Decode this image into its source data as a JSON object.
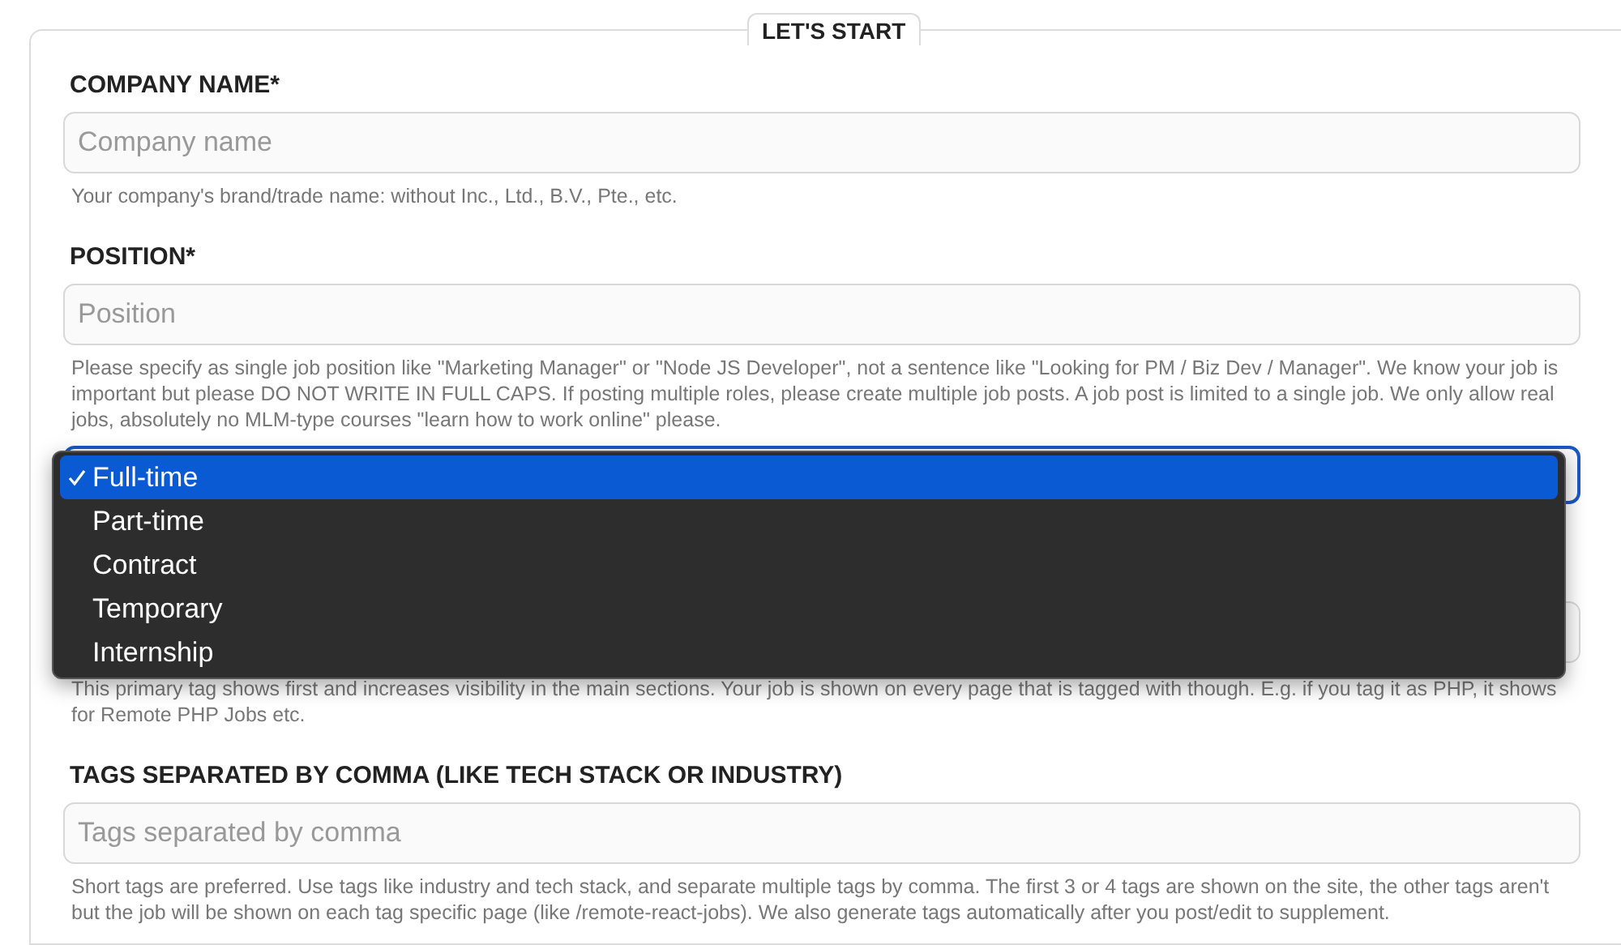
{
  "legend": "LET'S START",
  "fields": [
    {
      "kind": "text",
      "label": "COMPANY NAME*",
      "placeholder": "Company name",
      "help": "Your company's brand/trade name: without Inc., Ltd., B.V., Pte., etc."
    },
    {
      "kind": "text",
      "label": "POSITION*",
      "placeholder": "Position",
      "help": "Please specify as single job position like \"Marketing Manager\" or \"Node JS Developer\", not a sentence like \"Looking for PM / Biz Dev / Manager\". We know your job is important but please DO NOT WRITE IN FULL CAPS. If posting multiple roles, please create multiple job posts. A job post is limited to a single job. We only allow real jobs, absolutely no MLM-type courses \"learn how to work online\" please."
    },
    {
      "kind": "select",
      "focused": true,
      "options": [
        {
          "label": "Full-time",
          "selected": true
        },
        {
          "label": "Part-time",
          "selected": false
        },
        {
          "label": "Contract",
          "selected": false
        },
        {
          "label": "Temporary",
          "selected": false
        },
        {
          "label": "Internship",
          "selected": false
        }
      ]
    },
    {
      "kind": "covered",
      "help": "This primary tag shows first and increases visibility in the main sections. Your job is shown on every page that is tagged with though. E.g. if you tag it as PHP, it shows for Remote PHP Jobs etc."
    },
    {
      "kind": "text",
      "label": "TAGS SEPARATED BY COMMA (LIKE TECH STACK OR INDUSTRY)",
      "placeholder": "Tags separated by comma",
      "help": "Short tags are preferred. Use tags like industry and tech stack, and separate multiple tags by comma. The first 3 or 4 tags are shown on the site, the other tags aren't but the job will be shown on each tag specific page (like /remote-react-jobs). We also generate tags automatically after you post/edit to supplement."
    }
  ]
}
